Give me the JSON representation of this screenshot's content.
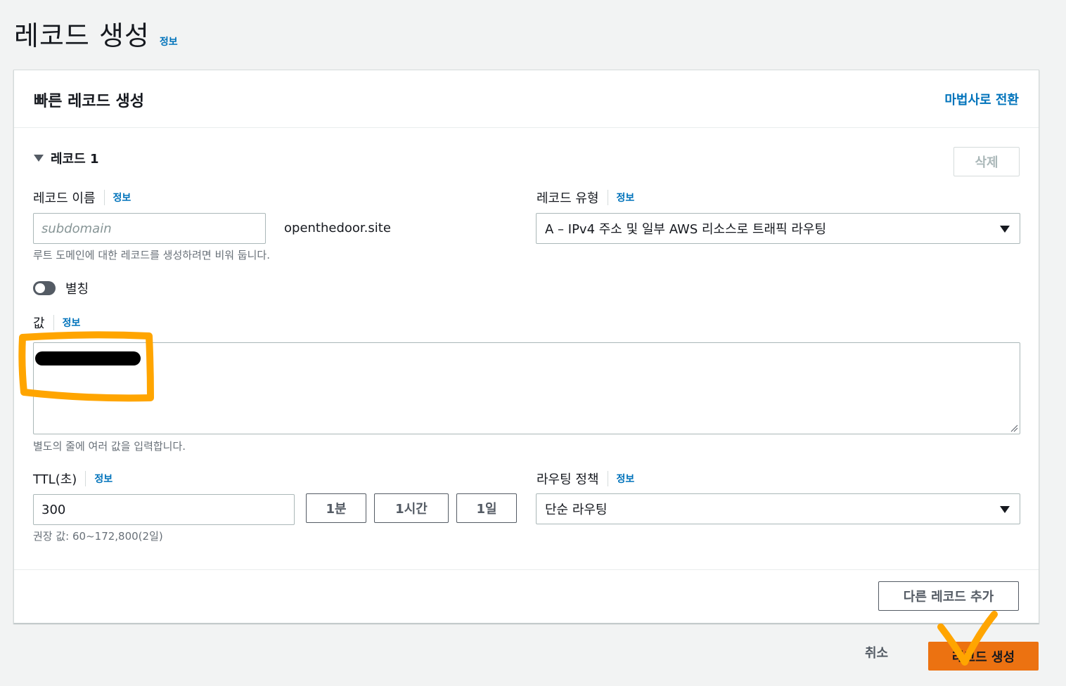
{
  "page": {
    "title": "레코드 생성",
    "info": "정보"
  },
  "card": {
    "title": "빠른 레코드 생성",
    "wizard_link": "마법사로 전환",
    "record_heading": "레코드 1",
    "delete_label": "삭제"
  },
  "record_name": {
    "label": "레코드 이름",
    "info": "정보",
    "placeholder": "subdomain",
    "value": "",
    "suffix": "openthedoor.site",
    "hint": "루트 도메인에 대한 레코드를 생성하려면 비워 둡니다."
  },
  "record_type": {
    "label": "레코드 유형",
    "info": "정보",
    "selected": "A – IPv4 주소 및 일부 AWS 리소스로 트래픽 라우팅"
  },
  "alias": {
    "label": "별칭",
    "enabled": false
  },
  "value": {
    "label": "값",
    "info": "정보",
    "hint": "별도의 줄에 여러 값을 입력합니다."
  },
  "ttl": {
    "label": "TTL(초)",
    "info": "정보",
    "value": "300",
    "presets": [
      "1분",
      "1시간",
      "1일"
    ],
    "hint": "권장 값: 60~172,800(2일)"
  },
  "routing": {
    "label": "라우팅 정책",
    "info": "정보",
    "selected": "단순 라우팅"
  },
  "footer": {
    "add_record": "다른 레코드 추가",
    "cancel": "취소",
    "create": "레코드 생성"
  },
  "colors": {
    "link": "#0073bb",
    "primary": "#ec7211",
    "annotation": "#ffa500"
  }
}
